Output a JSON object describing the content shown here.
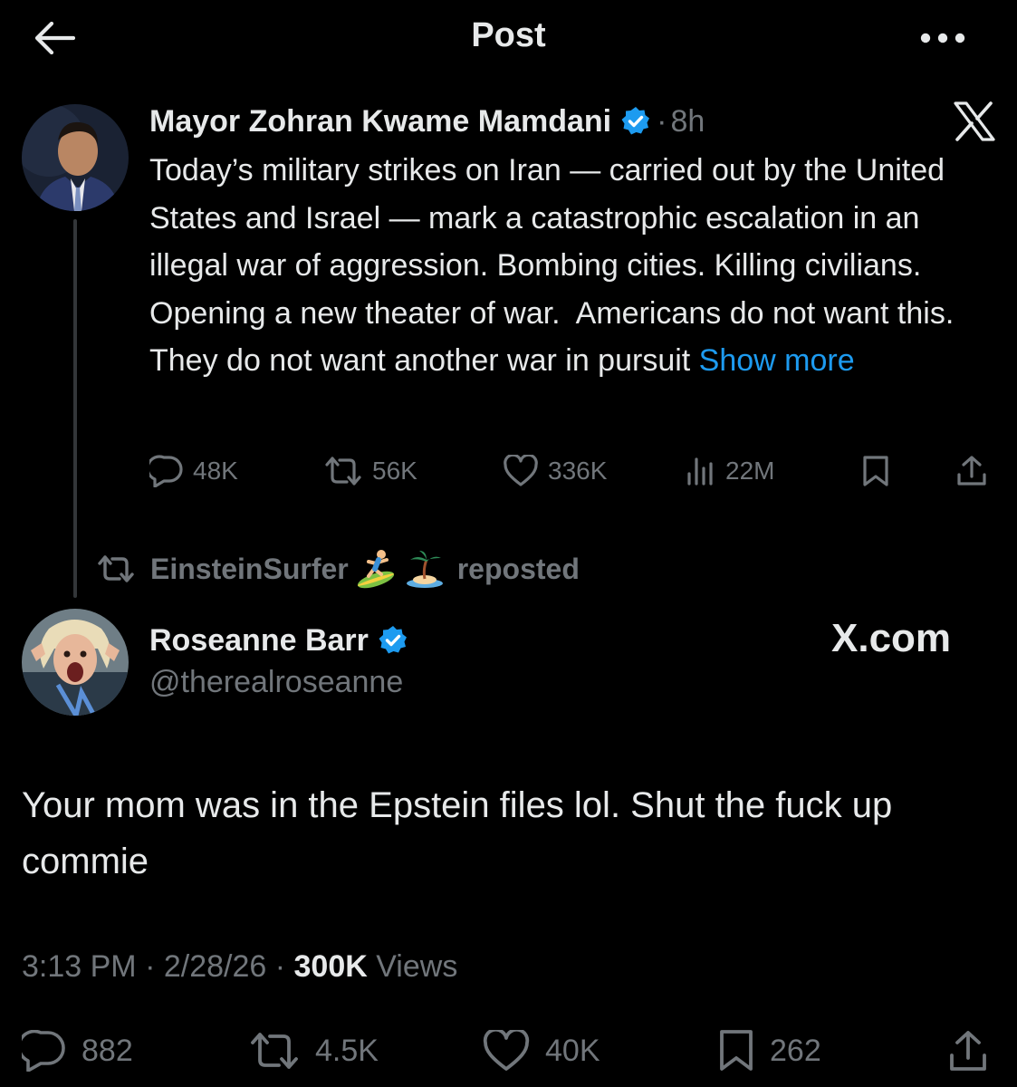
{
  "header": {
    "title": "Post",
    "back_icon": "arrow-left-icon",
    "more_icon": "more-dots-icon"
  },
  "parent_tweet": {
    "display_name": "Mayor Zohran Kwame Mamdani",
    "verified": true,
    "separator": "·",
    "time": "8h",
    "text": "Today’s military strikes on Iran — carried out by the United States and Israel — mark a catastrophic escalation in an illegal war of aggression. Bombing cities. Killing civilians. Opening a new theater of war.  Americans do not want this. They do not want another war in pursuit ",
    "show_more": "Show more",
    "stats": {
      "replies": "48K",
      "reposts": "56K",
      "likes": "336K",
      "views": "22M"
    }
  },
  "repost_banner": {
    "user": "EinsteinSurfer",
    "emojis": [
      "surfer-emoji",
      "island-emoji"
    ],
    "label": "reposted"
  },
  "main_tweet": {
    "display_name": "Roseanne Barr",
    "verified": true,
    "handle": "@therealroseanne",
    "watermark": "X.com",
    "text": "Your mom was in the Epstein files lol. Shut the fuck up commie",
    "time": "3:13 PM",
    "sep1": " · ",
    "date": "2/28/26",
    "sep2": " · ",
    "views_count": "300K",
    "views_label": " Views",
    "stats": {
      "replies": "882",
      "reposts": "4.5K",
      "likes": "40K",
      "bookmarks": "262"
    }
  },
  "colors": {
    "background": "#000000",
    "text": "#e7e9ea",
    "muted": "#71767b",
    "link": "#1d9bf0",
    "verified": "#1d9bf0"
  }
}
